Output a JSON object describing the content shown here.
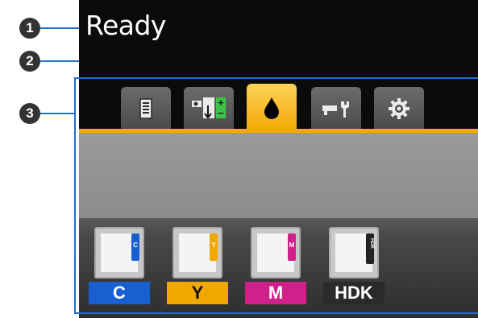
{
  "status": {
    "text": "Ready"
  },
  "callouts": [
    "1",
    "2",
    "3"
  ],
  "tabs": [
    {
      "icon": "print-queue-icon",
      "active": false
    },
    {
      "icon": "paper-feed-icon",
      "active": false
    },
    {
      "icon": "ink-drop-icon",
      "active": true
    },
    {
      "icon": "maintenance-icon",
      "active": false
    },
    {
      "icon": "settings-gear-icon",
      "active": false
    }
  ],
  "inks": [
    {
      "label": "C",
      "code": "C",
      "color": "#1a5fd0"
    },
    {
      "label": "Y",
      "code": "Y",
      "color": "#f0a800"
    },
    {
      "label": "M",
      "code": "M",
      "color": "#d0208a"
    },
    {
      "label": "HDK",
      "code": "HDK",
      "color": "#222222"
    }
  ],
  "colors": {
    "accent": "#f2a900",
    "callout_line": "#1e6fc8",
    "screen_bg": "#0b0b0b"
  }
}
